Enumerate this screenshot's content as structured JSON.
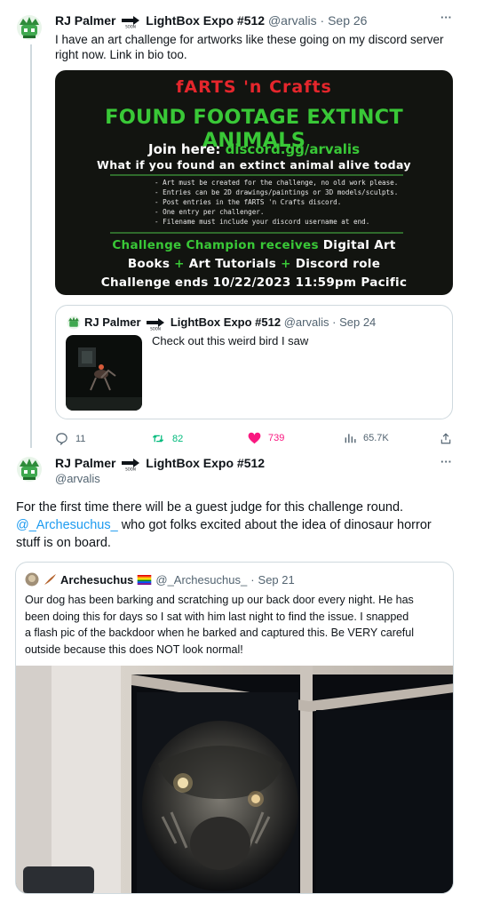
{
  "tweet1": {
    "author_name_a": "RJ Palmer",
    "author_name_b": "LightBox Expo #512",
    "handle": "@arvalis",
    "sep": "·",
    "date": "Sep 26",
    "more": "···",
    "text_line1": "I have an art challenge for artworks like these going on my discord server",
    "text_line2": "right now. Link in bio too.",
    "poster": {
      "title": "fARTS 'n Crafts",
      "headline": "FOUND FOOTAGE EXTINCT ANIMALS",
      "join_prefix": "Join here: ",
      "join_link": "discord.gg/arvalis",
      "question": "What if you found an extinct animal alive today",
      "rules": [
        "- Art must be created for the challenge, no old work please.",
        "- Entries can be 2D drawings/paintings or 3D models/sculpts.",
        "- Post entries in the fARTS 'n Crafts discord.",
        "- One entry per challenger.",
        "- Filename must include your discord username at end."
      ],
      "prize_line1_green": "Challenge Champion receives",
      "prize_line1_white": " Digital Art",
      "prize_line2_a": "Books ",
      "prize_line2_plus1": "+",
      "prize_line2_b": " Art Tutorials ",
      "prize_line2_plus2": "+",
      "prize_line2_c": " Discord role",
      "ends": "Challenge ends 10/22/2023 11:59pm Pacific"
    },
    "quote": {
      "author_name_a": "RJ Palmer",
      "author_name_b": "LightBox Expo #512",
      "handle": "@arvalis",
      "sep": "·",
      "date": "Sep 24",
      "text": "Check out this weird bird I saw"
    },
    "actions": {
      "replies": "11",
      "retweets": "82",
      "likes": "739",
      "views": "65.7K"
    }
  },
  "tweet2": {
    "author_name_a": "RJ Palmer",
    "author_name_b": "LightBox Expo #512",
    "handle": "@arvalis",
    "more": "···",
    "text_line1": "For the first time there will be a guest judge for this challenge round.",
    "mention": "@_Archesuchus_",
    "text_line2_rest": " who got folks excited about the idea of dinosaur horror",
    "text_line3": "stuff is on board.",
    "quote": {
      "author_name": "Archesuchus",
      "handle": "@_Archesuchus_",
      "sep": "·",
      "date": "Sep 21",
      "text_lines": [
        "Our dog has been barking and scratching up our back door every night. He has",
        "been doing this for days so I sat with him last night to find the issue. I snapped",
        "a flash pic of the backdoor when he barked and captured this. Be VERY careful",
        "outside because this does NOT look normal!"
      ]
    }
  },
  "colors": {
    "link": "#1d9bf0",
    "retweet": "#00ba7c",
    "like": "#f91880",
    "poster_green": "#39c837",
    "poster_red": "#e5262c"
  },
  "icons": [
    "avatar-plant-icon",
    "soon-arrow-icon",
    "reply-icon",
    "retweet-icon",
    "heart-icon",
    "views-icon",
    "share-icon",
    "more-icon",
    "pride-flag-icon",
    "feather-icon"
  ]
}
